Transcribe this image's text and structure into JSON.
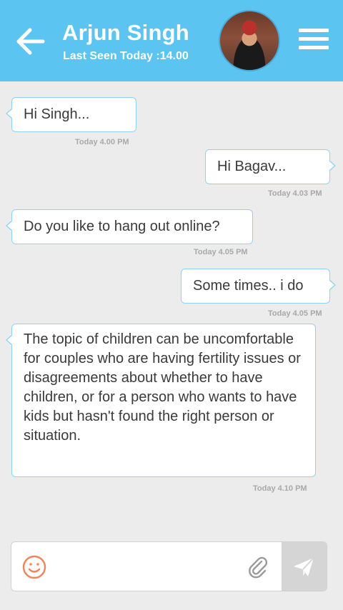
{
  "header": {
    "title": "Arjun Singh",
    "last_seen": "Last Seen Today :14.00"
  },
  "icons": {
    "back": "back-arrow-icon",
    "menu": "hamburger-menu-icon",
    "emoji": "smiley-icon",
    "attach": "paperclip-icon",
    "send": "send-plane-icon"
  },
  "colors": {
    "header_bg": "#5bc4f1",
    "bubble_border": "#8fd3f3",
    "emoji": "#f0875a",
    "send_bg": "#d5d5d5"
  },
  "messages": [
    {
      "direction": "in",
      "text": "Hi Singh...",
      "time": "Today 4.00 PM"
    },
    {
      "direction": "out",
      "text": "Hi Bagav...",
      "time": "Today 4.03 PM"
    },
    {
      "direction": "in",
      "text": "Do you like to hang out online?",
      "time": "Today 4.05 PM"
    },
    {
      "direction": "out",
      "text": "Some times.. i do",
      "time": "Today 4.05 PM"
    },
    {
      "direction": "in",
      "text": "The topic of children can be uncomfortable for couples who are having fertility issues or disagreements about whether to have children, or for a person who wants to have kids but hasn't found the right person or situation.",
      "time": "Today 4.10 PM"
    }
  ],
  "composer": {
    "value": "",
    "placeholder": ""
  }
}
